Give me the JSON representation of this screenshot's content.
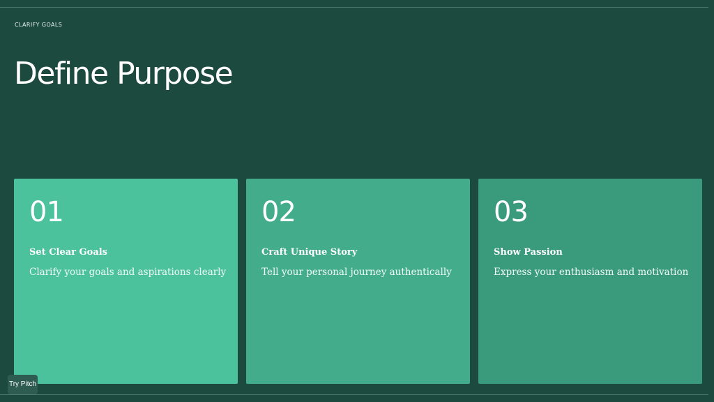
{
  "slide": {
    "eyebrow": "CLARIFY GOALS",
    "title": "Define Purpose",
    "cards": [
      {
        "number": "01",
        "heading": "Set Clear Goals",
        "text": "Clarify your goals and aspirations clearly"
      },
      {
        "number": "02",
        "heading": "Craft Unique Story",
        "text": "Tell your personal journey authentically"
      },
      {
        "number": "03",
        "heading": "Show Passion",
        "text": "Express your enthusiasm and motivation"
      }
    ]
  },
  "badge": {
    "label": "Try Pitch"
  },
  "colors": {
    "background": "#1c4a3f",
    "card_1": "#4bc19c",
    "card_2": "#43ac8b",
    "card_3": "#3a9a7c",
    "rule": "#4c7a6c"
  }
}
